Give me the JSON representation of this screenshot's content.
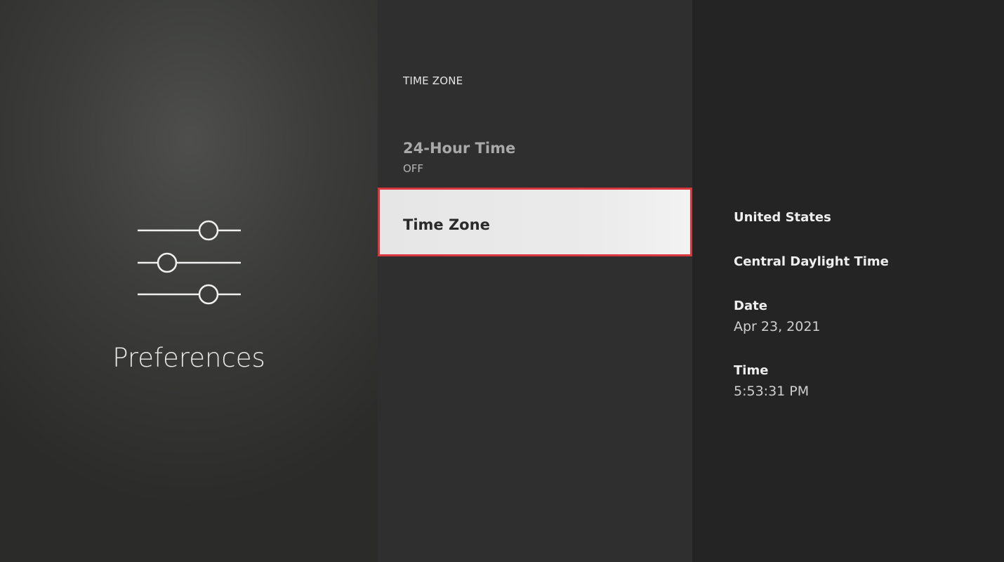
{
  "sidebar": {
    "icon": "sliders-icon",
    "title": "Preferences"
  },
  "menu": {
    "heading": "TIME ZONE",
    "items": [
      {
        "label": "24-Hour Time",
        "value": "OFF"
      },
      {
        "label": "Time Zone",
        "selected": true
      }
    ]
  },
  "details": {
    "region": "United States",
    "zone": "Central Daylight Time",
    "date_label": "Date",
    "date_value": "Apr 23, 2021",
    "time_label": "Time",
    "time_value": "5:53:31 PM"
  },
  "colors": {
    "focus_border": "#d9363e",
    "selected_bg": "#e8e8e8"
  }
}
